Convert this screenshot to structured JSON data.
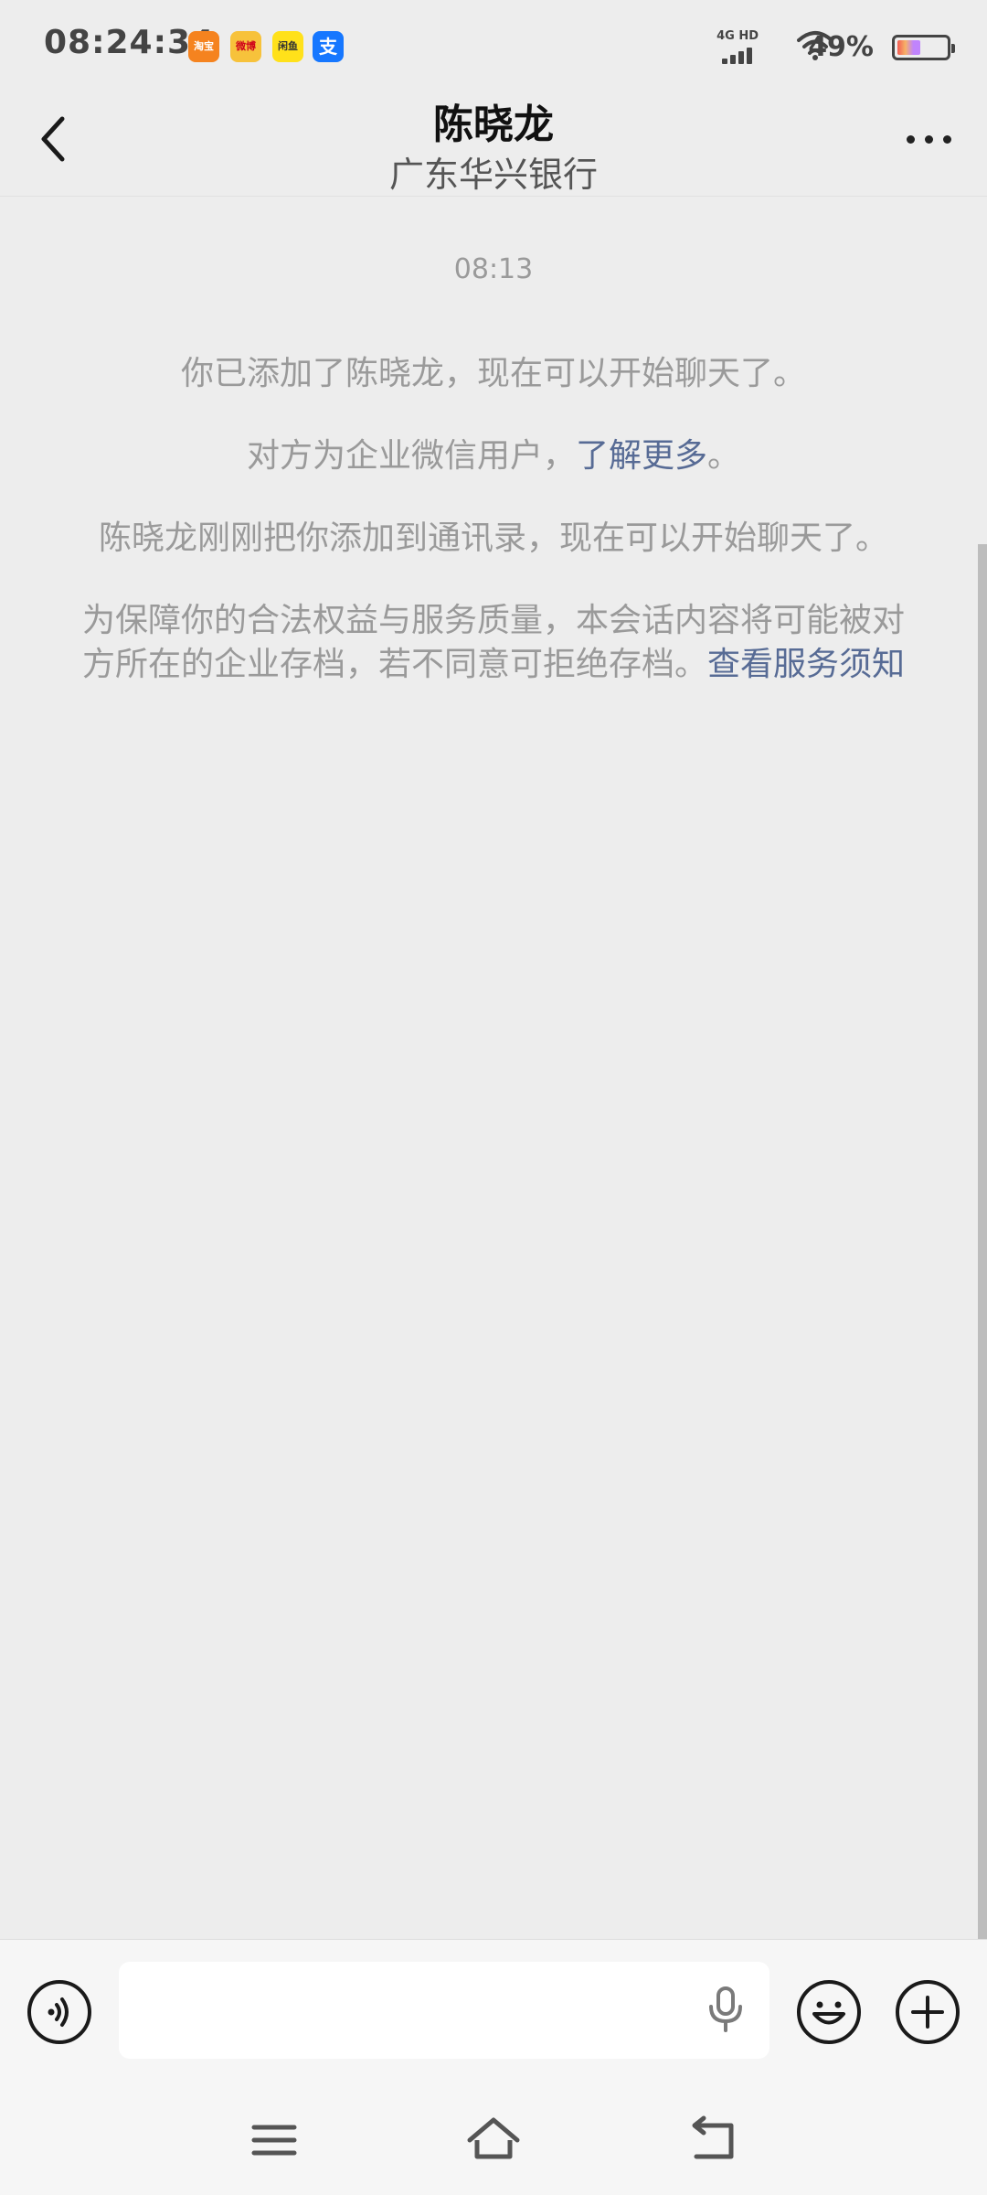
{
  "status_bar": {
    "time": "08:24:34",
    "app_icons": [
      {
        "name": "taobao-icon",
        "label": "淘宝",
        "color": "#f5831f"
      },
      {
        "name": "weibo-icon",
        "label": "微博",
        "color": "#f7c23b"
      },
      {
        "name": "xianyu-icon",
        "label": "闲鱼",
        "color": "#ffe11a"
      },
      {
        "name": "alipay-icon",
        "label": "支",
        "color": "#1677ff"
      }
    ],
    "network": "4G HD",
    "battery_percent": "49%",
    "battery_level": 0.49
  },
  "header": {
    "title": "陈晓龙",
    "subtitle": "广东华兴银行"
  },
  "chat": {
    "timestamp": "08:13",
    "messages": {
      "added": "你已添加了陈晓龙，现在可以开始聊天了。",
      "enterprise_prefix": "对方为企业微信用户，",
      "enterprise_link": "了解更多",
      "enterprise_suffix": "。",
      "contact": "陈晓龙刚刚把你添加到通讯录，现在可以开始聊天了。",
      "archive_text": "为保障你的合法权益与服务质量，本会话内容将可能被对方所在的企业存档，若不同意可拒绝存档。",
      "archive_link": "查看服务须知"
    }
  },
  "input_bar": {
    "placeholder": ""
  },
  "colors": {
    "background": "#ededed",
    "link": "#576b95",
    "system_text": "#9a9a9a"
  }
}
